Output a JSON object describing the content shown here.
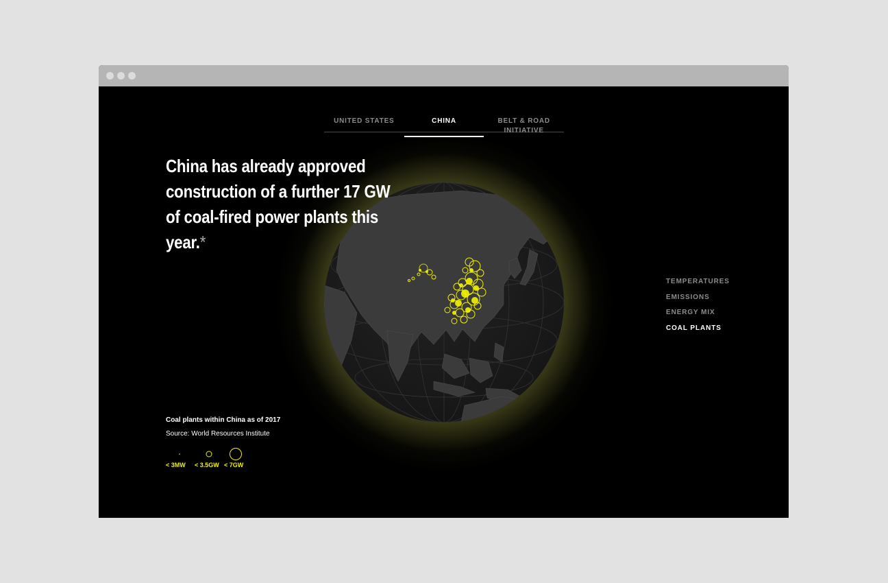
{
  "tabs": [
    {
      "label": "UNITED STATES",
      "active": false
    },
    {
      "label": "CHINA",
      "active": true
    },
    {
      "label": "BELT & ROAD INITIATIVE",
      "active": false
    }
  ],
  "headline": {
    "line1": "China has already approved",
    "line2": "construction of a further 17 GW",
    "line3": "of coal-fired power plants this year.",
    "asterisk": "*"
  },
  "side_menu": [
    {
      "label": "TEMPERATURES",
      "active": false
    },
    {
      "label": "EMISSIONS",
      "active": false
    },
    {
      "label": "ENERGY MIX",
      "active": false
    },
    {
      "label": "COAL PLANTS",
      "active": true
    }
  ],
  "legend": {
    "title": "Coal plants within China as of 2017",
    "source": "Source: World Resources Institute",
    "sizes": [
      "< 3MW",
      "< 3.5GW",
      "< 7GW"
    ]
  },
  "colors": {
    "accent": "#f3f300",
    "glow": "#d8d87a",
    "land": "#3a3a3a",
    "ocean": "#1e1e1e",
    "background": "#000000"
  },
  "icons": {
    "window_controls": [
      "close-dot-icon",
      "minimize-dot-icon",
      "zoom-dot-icon"
    ]
  }
}
